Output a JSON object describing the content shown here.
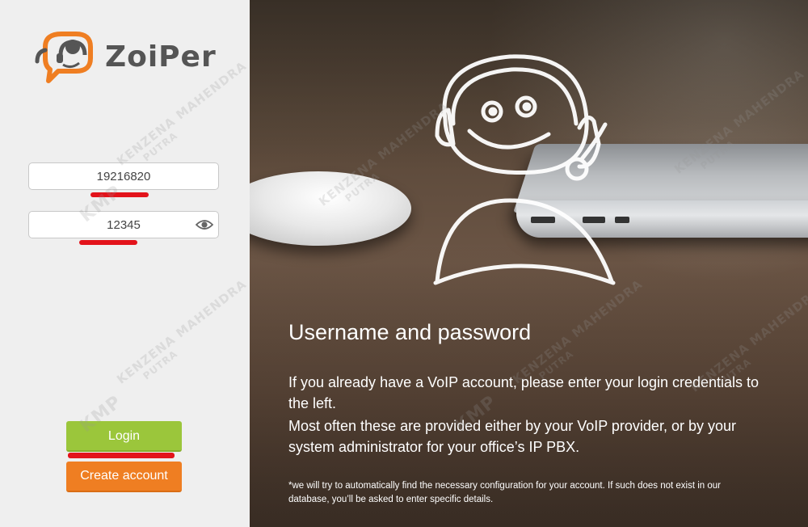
{
  "app": {
    "logo_text": "ZoiPer"
  },
  "login_form": {
    "username_value": "19216820",
    "password_value": "12345",
    "login_label": "Login",
    "create_account_label": "Create account"
  },
  "info": {
    "heading": "Username and password",
    "paragraph1": " If you already have a VoIP account, please enter your login credentials to the left.",
    "paragraph2": "Most often these are provided either by your VoIP provider, or by your system administrator for your office’s IP PBX.",
    "note": "*we will try to automatically find the necessary configuration for your account. If such does not exist in our database, you’ll be asked to enter specific details."
  },
  "watermark": {
    "name": "KENZENA MAHENDRA",
    "sub": "PUTRA",
    "mark": "KMP"
  },
  "colors": {
    "login_button": "#9bc63b",
    "create_button": "#ef7e22",
    "logo_orange": "#ef7e22",
    "logo_gray": "#555555",
    "redaction_mark": "#e3131b"
  },
  "icons": {
    "logo": "zoiper-headset-logo-icon",
    "show_password": "eye-icon",
    "illustration": "smiling-operator-headset-illustration"
  }
}
